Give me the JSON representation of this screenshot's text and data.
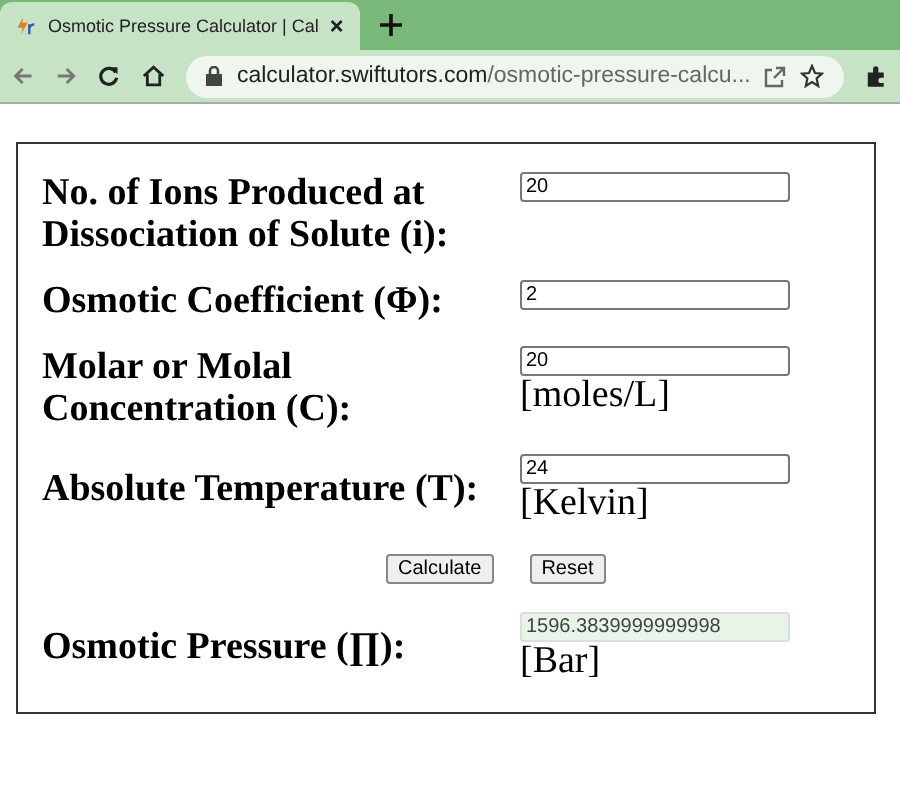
{
  "browser": {
    "tab_title": "Osmotic Pressure Calculator | Cal",
    "url_host": "calculator.swiftutors.com",
    "url_path": "/osmotic-pressure-calcu..."
  },
  "form": {
    "rows": [
      {
        "label": "No. of Ions Produced at Dissociation of Solute (i):",
        "value": "20"
      },
      {
        "label": "Osmotic Coefficient (Φ):",
        "value": "2"
      },
      {
        "label": "Molar or Molal Concentration (C):",
        "value": "20",
        "unit": "[moles/L]"
      },
      {
        "label": "Absolute Temperature (T):",
        "value": "24",
        "unit": "[Kelvin]"
      }
    ],
    "buttons": [
      "Calculate",
      "Reset"
    ],
    "result": {
      "label": "Osmotic Pressure (∏):",
      "value": "1596.3839999999998",
      "unit": "[Bar]"
    }
  }
}
